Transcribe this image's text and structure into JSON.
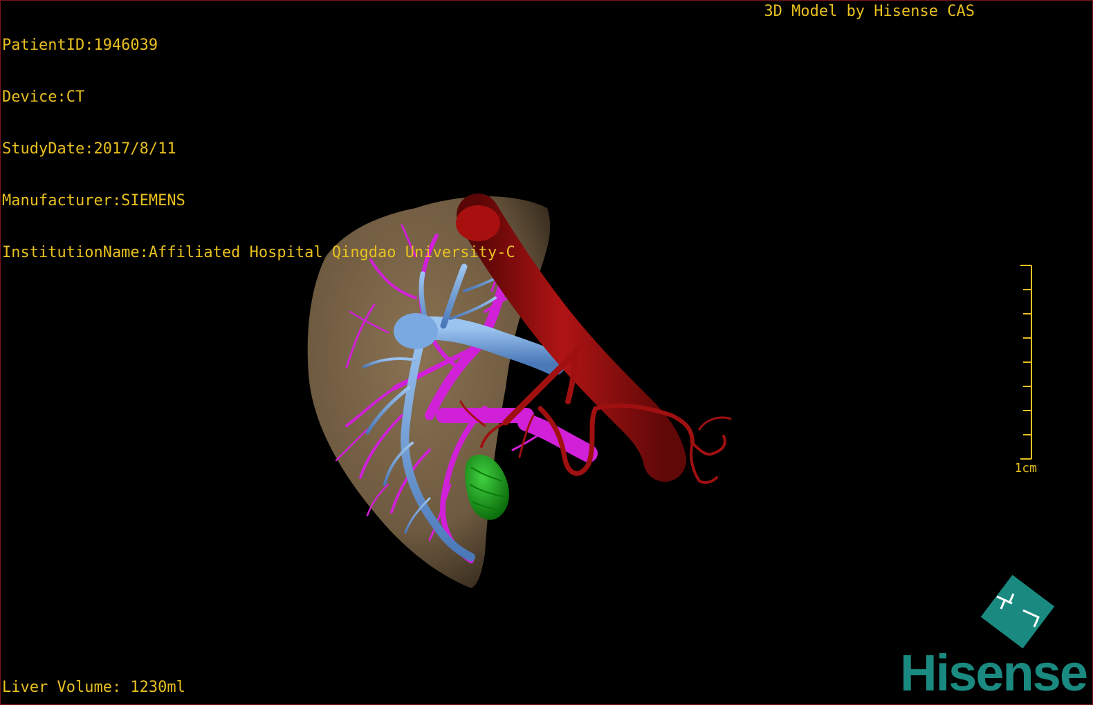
{
  "header": {
    "patient_id": "PatientID:1946039",
    "device": "Device:CT",
    "study_date": "StudyDate:2017/8/11",
    "manufacturer": "Manufacturer:SIEMENS",
    "institution": "InstitutionName:Affiliated Hospital Qingdao University-C",
    "brand_title": "3D Model by Hisense CAS"
  },
  "footer": {
    "liver_volume": "Liver Volume: 1230ml"
  },
  "scale_bar": {
    "label": "1cm"
  },
  "logo": {
    "text": "Hisense",
    "icon": "hisense-diamond-icon"
  },
  "colors": {
    "overlay_text": "#e8c020",
    "liver": "#7a6448",
    "portal_vein": "#6a9ad8",
    "hepatic_vein": "#d020d8",
    "artery": "#a01010",
    "gallbladder": "#20a020",
    "logo": "#1a8a80"
  }
}
